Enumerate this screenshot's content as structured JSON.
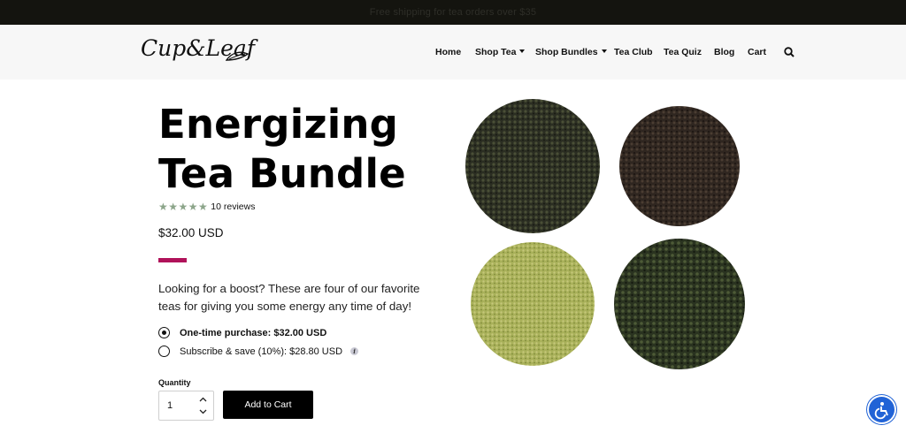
{
  "announcement": "Free shipping for tea orders over $35",
  "brand": {
    "logo_text": "Cup&Leaf"
  },
  "nav": {
    "items": [
      {
        "label": "Home"
      },
      {
        "label": "Shop Tea"
      },
      {
        "label": "Shop Bundles"
      },
      {
        "label": "Tea Club"
      },
      {
        "label": "Tea Quiz"
      },
      {
        "label": "Blog"
      },
      {
        "label": "Cart"
      }
    ],
    "search_icon": "search-icon"
  },
  "product": {
    "title_line1": "Energizing",
    "title_line2": "Tea Bundle",
    "rating_stars": 5,
    "reviews": "10 reviews",
    "price": "$32.00 USD",
    "description": "Looking for a boost? These are four of our favorite teas for giving you some energy any time of day!",
    "options": [
      {
        "label": "One-time purchase: $32.00 USD",
        "selected": true
      },
      {
        "label": "Subscribe & save (10%): $28.80 USD",
        "selected": false
      }
    ],
    "quantity_label": "Quantity",
    "quantity_value": "1",
    "add_to_cart": "Add to Cart"
  },
  "colors": {
    "accent": "#b0125a",
    "star": "#8ca58a",
    "topbar": "#14140f",
    "a11y": "#2163d6"
  }
}
